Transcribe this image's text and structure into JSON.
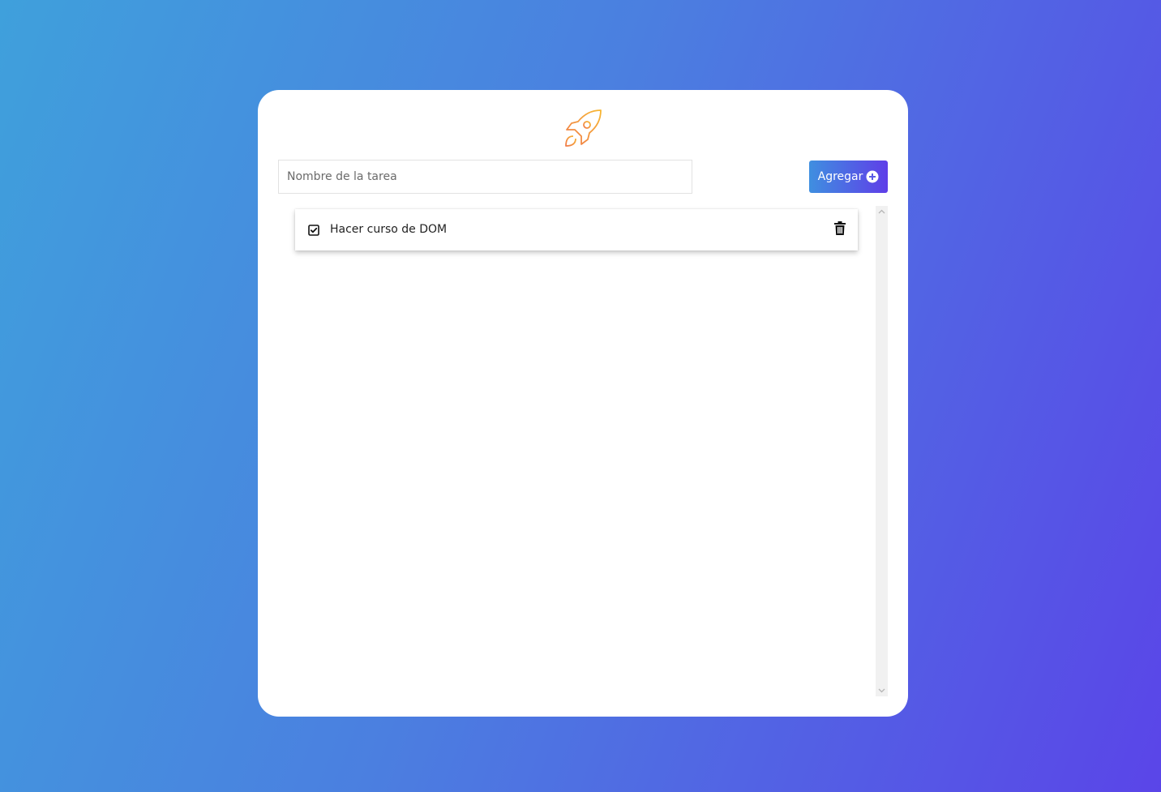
{
  "app": {
    "logo": "rocket-icon",
    "colors": {
      "background_start": "#3fa0dc",
      "background_end": "#5a45e8",
      "logo_orange": "#f5a030",
      "button_start": "#3f8fe0",
      "button_end": "#5f3ee8"
    }
  },
  "form": {
    "input_placeholder": "Nombre de la tarea",
    "input_value": "",
    "add_button_label": "Agregar",
    "add_button_icon": "plus-circle-icon"
  },
  "tasks": [
    {
      "label": "Hacer curso de DOM",
      "checkbox_icon": "check-square-icon",
      "delete_icon": "trash-icon"
    }
  ]
}
